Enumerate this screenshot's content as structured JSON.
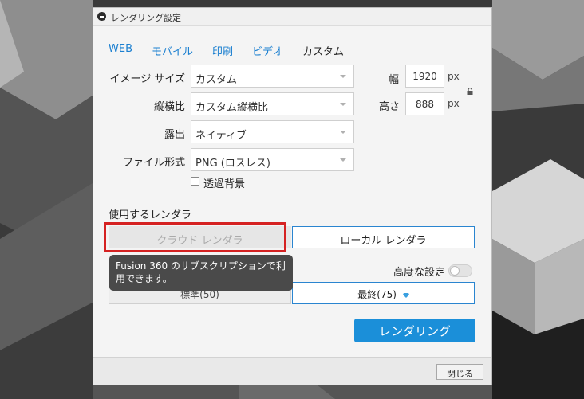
{
  "dialog": {
    "title": "レンダリング設定"
  },
  "tabs": [
    {
      "label": "WEB",
      "active": false
    },
    {
      "label": "モバイル",
      "active": false
    },
    {
      "label": "印刷",
      "active": false
    },
    {
      "label": "ビデオ",
      "active": false
    },
    {
      "label": "カスタム",
      "active": true
    }
  ],
  "fields": {
    "image_size": {
      "label": "イメージ サイズ",
      "value": "カスタム"
    },
    "aspect_ratio": {
      "label": "縦横比",
      "value": "カスタム縦横比"
    },
    "exposure": {
      "label": "露出",
      "value": "ネイティブ"
    },
    "file_format": {
      "label": "ファイル形式",
      "value": "PNG (ロスレス)"
    },
    "transparent_bg": {
      "label": "透過背景",
      "checked": false
    }
  },
  "dimensions": {
    "width_label": "幅",
    "width_value": "1920",
    "height_label": "高さ",
    "height_value": "888",
    "unit": "px"
  },
  "renderer": {
    "section_label": "使用するレンダラ",
    "cloud_label": "クラウド レンダラ",
    "local_label": "ローカル レンダラ",
    "tooltip": "Fusion 360 のサブスクリプションで利用できます。"
  },
  "quality": {
    "advanced_label": "高度な設定",
    "standard_label": "標準(50)",
    "final_label": "最終(75)"
  },
  "actions": {
    "render_label": "レンダリング",
    "close_label": "閉じる"
  },
  "colors": {
    "accent": "#1b8fd9",
    "highlight_outline": "#d52222",
    "tab_link": "#1a7fd0"
  }
}
